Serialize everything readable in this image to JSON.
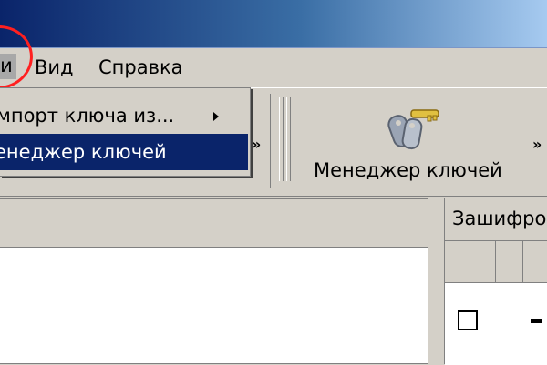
{
  "menubar": {
    "items": [
      "и",
      "Вид",
      "Справка"
    ]
  },
  "dropdown": {
    "items": [
      {
        "label": "мпорт ключа из...",
        "submenu": true
      },
      {
        "label": "енеджер ключей",
        "highlighted": true
      }
    ]
  },
  "toolbar": {
    "key_manager_label": "Менеджер ключей",
    "overflow_label": "»"
  },
  "right_pane": {
    "title": "Зашифро"
  },
  "colors": {
    "highlight": "#0a246a",
    "annotation_circle": "#ff2020",
    "face": "#d4d0c8"
  }
}
